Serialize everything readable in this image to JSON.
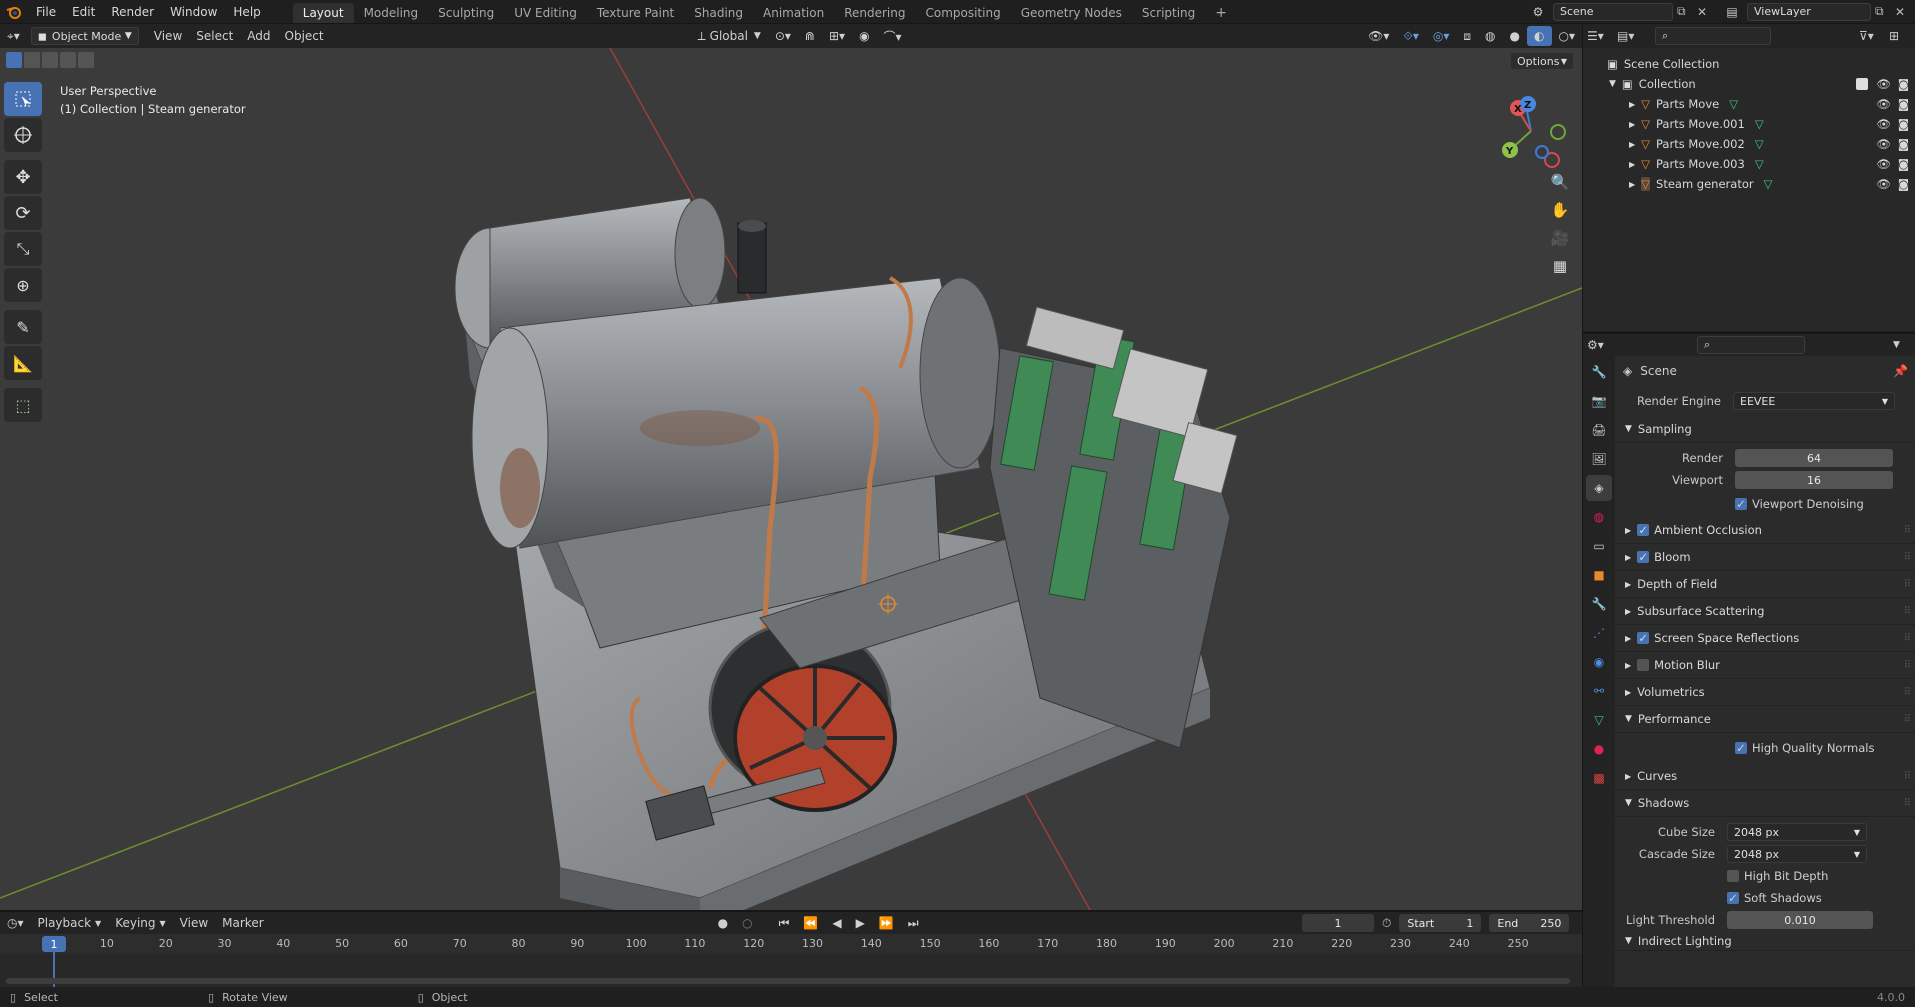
{
  "topbar": {
    "menus": [
      "File",
      "Edit",
      "Render",
      "Window",
      "Help"
    ],
    "workspaces": [
      "Layout",
      "Modeling",
      "Sculpting",
      "UV Editing",
      "Texture Paint",
      "Shading",
      "Animation",
      "Rendering",
      "Compositing",
      "Geometry Nodes",
      "Scripting"
    ],
    "active_workspace": "Layout",
    "scene_name": "Scene",
    "view_layer_name": "ViewLayer"
  },
  "viewport_header": {
    "mode": "Object Mode",
    "menus": [
      "View",
      "Select",
      "Add",
      "Object"
    ],
    "transform_orientation": "Global",
    "options_label": "Options"
  },
  "viewport": {
    "perspective_label": "User Perspective",
    "context_label": "(1) Collection | Steam generator",
    "gizmo_axes": [
      "X",
      "Y",
      "Z"
    ]
  },
  "outliner": {
    "root": "Scene Collection",
    "collection": "Collection",
    "items": [
      {
        "name": "Parts Move"
      },
      {
        "name": "Parts Move.001"
      },
      {
        "name": "Parts Move.002"
      },
      {
        "name": "Parts Move.003"
      },
      {
        "name": "Steam generator"
      }
    ]
  },
  "properties": {
    "context": "Scene",
    "render_engine_label": "Render Engine",
    "render_engine": "EEVEE",
    "sampling": {
      "title": "Sampling",
      "render_label": "Render",
      "render_value": "64",
      "viewport_label": "Viewport",
      "viewport_value": "16",
      "denoise_label": "Viewport Denoising"
    },
    "panels": [
      {
        "label": "Ambient Occlusion",
        "checkbox": true,
        "checked": true
      },
      {
        "label": "Bloom",
        "checkbox": true,
        "checked": true
      },
      {
        "label": "Depth of Field",
        "checkbox": false,
        "checked": false
      },
      {
        "label": "Subsurface Scattering",
        "checkbox": false,
        "checked": false
      },
      {
        "label": "Screen Space Reflections",
        "checkbox": true,
        "checked": true
      },
      {
        "label": "Motion Blur",
        "checkbox": true,
        "checked": false
      },
      {
        "label": "Volumetrics",
        "checkbox": false,
        "checked": false
      }
    ],
    "performance": {
      "title": "Performance",
      "hq_normals_label": "High Quality Normals"
    },
    "curves_title": "Curves",
    "shadows": {
      "title": "Shadows",
      "cube_size_label": "Cube Size",
      "cube_size": "2048 px",
      "cascade_size_label": "Cascade Size",
      "cascade_size": "2048 px",
      "high_bit_depth_label": "High Bit Depth",
      "soft_shadows_label": "Soft Shadows",
      "light_threshold_label": "Light Threshold",
      "light_threshold": "0.010"
    },
    "indirect_lighting_title": "Indirect Lighting"
  },
  "timeline": {
    "menus": [
      "Playback",
      "Keying",
      "View",
      "Marker"
    ],
    "current_frame": "1",
    "start_label": "Start",
    "start_value": "1",
    "end_label": "End",
    "end_value": "250",
    "ticks": [
      "10",
      "20",
      "30",
      "40",
      "50",
      "60",
      "70",
      "80",
      "90",
      "100",
      "110",
      "120",
      "130",
      "140",
      "150",
      "160",
      "170",
      "180",
      "190",
      "200",
      "210",
      "220",
      "230",
      "240",
      "250"
    ],
    "playhead_label": "1"
  },
  "statusbar": {
    "select": "Select",
    "rotate": "Rotate View",
    "object": "Object",
    "version": "4.0.0"
  }
}
